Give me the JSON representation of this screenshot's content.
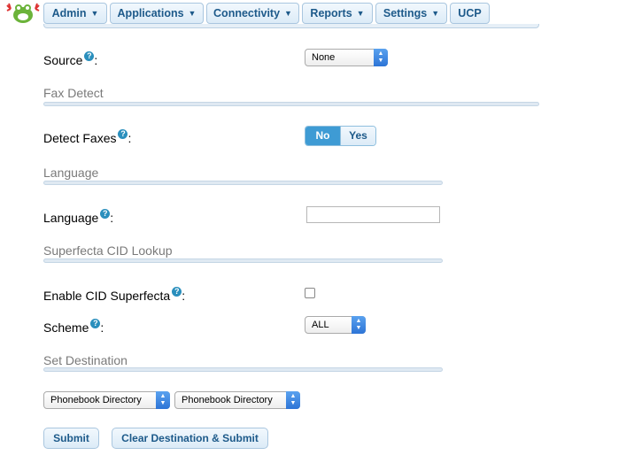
{
  "nav": {
    "items": [
      {
        "label": "Admin",
        "dropdown": true
      },
      {
        "label": "Applications",
        "dropdown": true
      },
      {
        "label": "Connectivity",
        "dropdown": true
      },
      {
        "label": "Reports",
        "dropdown": true
      },
      {
        "label": "Settings",
        "dropdown": true
      },
      {
        "label": "UCP",
        "dropdown": false
      }
    ],
    "caret": "▼"
  },
  "help_glyph": "?",
  "form": {
    "source": {
      "label": "Source",
      "colon": ":",
      "value": "None"
    },
    "fax_detect": {
      "section": "Fax Detect",
      "label": "Detect Faxes",
      "colon": ":",
      "no": "No",
      "yes": "Yes",
      "selected": "No"
    },
    "language": {
      "section": "Language",
      "label": "Language",
      "colon": ":",
      "value": ""
    },
    "superfecta": {
      "section": "Superfecta CID Lookup",
      "enable_label": "Enable CID Superfecta",
      "colon": ":",
      "enabled": false,
      "scheme_label": "Scheme",
      "scheme_value": "ALL"
    },
    "destination": {
      "section": "Set Destination",
      "type_value": "Phonebook Directory",
      "target_value": "Phonebook Directory"
    }
  },
  "buttons": {
    "submit": "Submit",
    "clear_submit": "Clear Destination & Submit"
  }
}
